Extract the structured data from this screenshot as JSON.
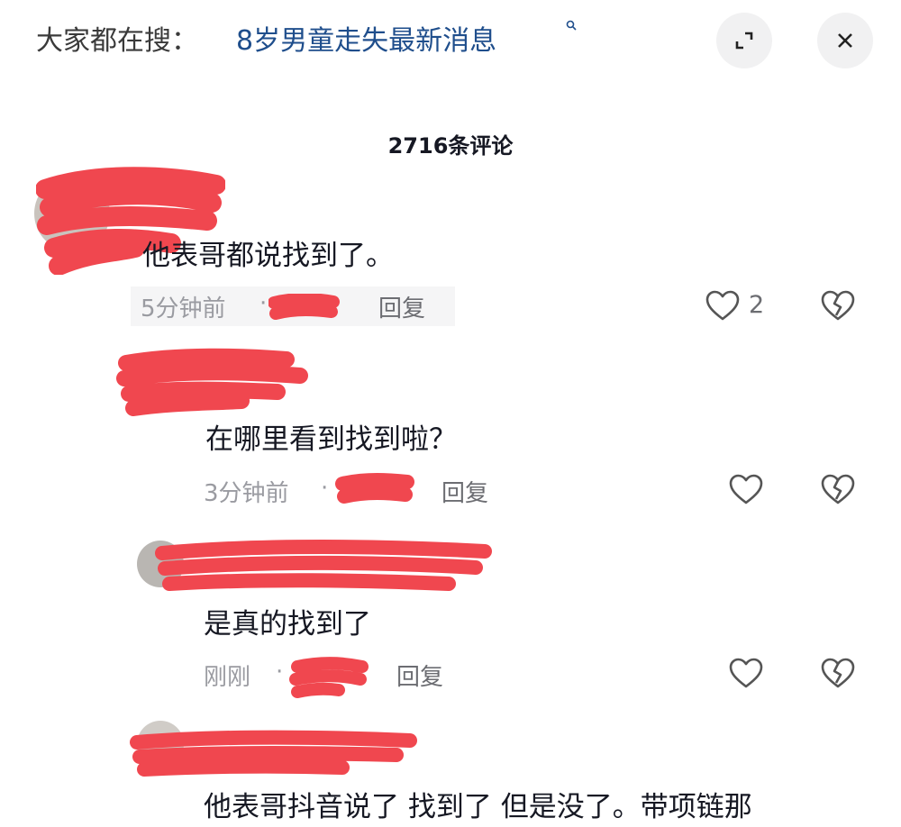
{
  "search_bar": {
    "prefix": "大家都在搜：",
    "term": "8岁男童走失最新消息"
  },
  "header": {
    "comment_count": "2716条评论"
  },
  "comments": [
    {
      "text": "他表哥都说找到了。",
      "time": "5分钟前",
      "reply_label": "回复",
      "like_count": "2",
      "level": "top"
    },
    {
      "text": "在哪里看到找到啦？",
      "time": "3分钟前",
      "reply_label": "回复",
      "level": "reply"
    },
    {
      "text": "是真的找到了",
      "time": "刚刚",
      "reply_label": "回复",
      "level": "reply"
    },
    {
      "text": "他表哥抖音说了 找到了 但是没了。带项链那",
      "level": "reply"
    }
  ],
  "icons": {
    "search": "search-icon",
    "expand": "expand-icon",
    "close": "close-icon",
    "like": "heart-icon",
    "dislike": "broken-heart-icon"
  },
  "colors": {
    "link": "#1f4e8c",
    "meta": "#9a9ba1",
    "redaction": "#f0474f"
  }
}
